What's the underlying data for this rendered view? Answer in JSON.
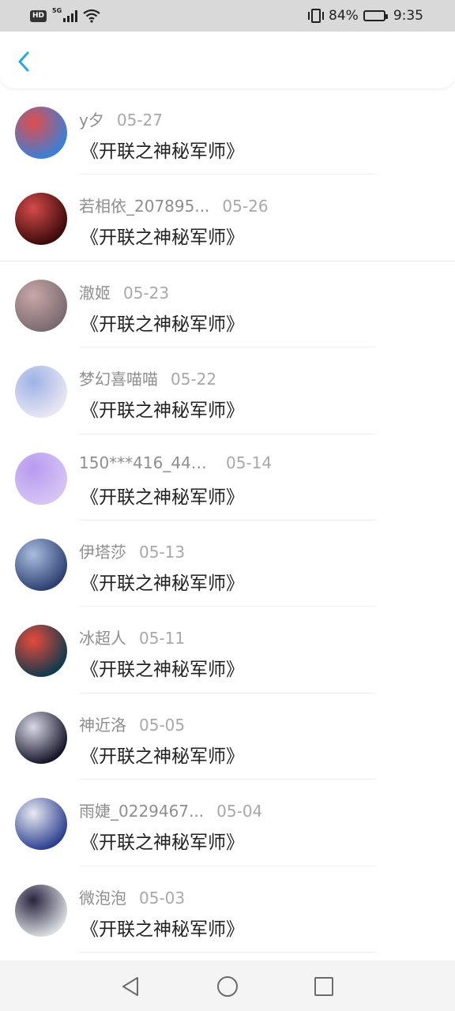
{
  "status_bar": {
    "network_badge": "HD",
    "network_type": "5G",
    "battery_percent": "84%",
    "battery_level": 0.84,
    "time": "9:35"
  },
  "header": {
    "back_icon": "chevron-left-icon"
  },
  "colors": {
    "accent": "#2aa7e0",
    "text": "#222222",
    "meta": "#8e8e8e"
  },
  "items": [
    {
      "name": "y夕",
      "date": "05-27",
      "title": "《开联之神秘军师》",
      "avatar_colors": [
        "#3a7fd8",
        "#e04d4d"
      ]
    },
    {
      "name": "若相依_207895...",
      "date": "05-26",
      "title": "《开联之神秘军师》",
      "avatar_colors": [
        "#3b0a0a",
        "#d44a4a"
      ]
    },
    {
      "name": "澈姬",
      "date": "05-23",
      "title": "《开联之神秘军师》",
      "avatar_colors": [
        "#7a6a70",
        "#c9a7a7"
      ]
    },
    {
      "name": "梦幻喜喵喵",
      "date": "05-22",
      "title": "《开联之神秘军师》",
      "avatar_colors": [
        "#e9e6f3",
        "#9db2e6"
      ]
    },
    {
      "name": "150***416_447...",
      "date": "05-14",
      "title": "《开联之神秘军师》",
      "avatar_colors": [
        "#d6c5f5",
        "#b89af0"
      ]
    },
    {
      "name": "伊塔莎",
      "date": "05-13",
      "title": "《开联之神秘军师》",
      "avatar_colors": [
        "#2d3f70",
        "#a9bde0"
      ]
    },
    {
      "name": "冰超人",
      "date": "05-11",
      "title": "《开联之神秘军师》",
      "avatar_colors": [
        "#0f3a4d",
        "#e84a3a"
      ]
    },
    {
      "name": "神近洛",
      "date": "05-05",
      "title": "《开联之神秘军师》",
      "avatar_colors": [
        "#15152a",
        "#d8d8e6"
      ]
    },
    {
      "name": "雨婕_0229467...",
      "date": "05-04",
      "title": "《开联之神秘军师》",
      "avatar_colors": [
        "#2c3f8f",
        "#e9eaf2"
      ]
    },
    {
      "name": "微泡泡",
      "date": "05-03",
      "title": "《开联之神秘军师》",
      "avatar_colors": [
        "#d8dce0",
        "#2a2440"
      ]
    }
  ],
  "nav_bar": {
    "back": "triangle-back-icon",
    "home": "circle-home-icon",
    "recents": "square-recents-icon"
  }
}
